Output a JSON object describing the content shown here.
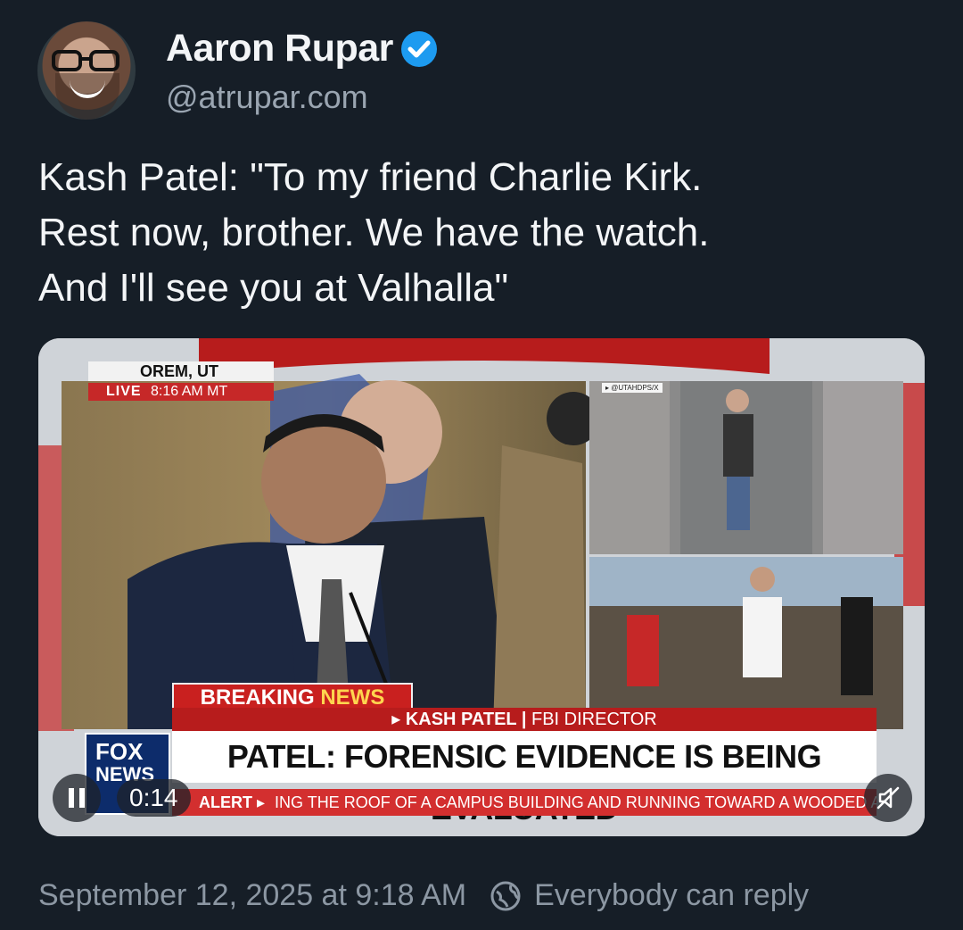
{
  "author": {
    "display_name": "Aaron Rupar",
    "handle": "@atrupar.com"
  },
  "post": {
    "text_lines": [
      "Kash Patel: \"To my friend Charlie Kirk.",
      "Rest now, brother. We have the watch.",
      "And I'll see you at Valhalla\""
    ]
  },
  "video": {
    "location": "OREM, UT",
    "live_label": "LIVE",
    "live_time": "8:16 AM MT",
    "source_tag": "▸ @UTAHDPS/X",
    "breaking": "BREAKING",
    "breaking_news": "NEWS",
    "speaker_name": "▸ KASH PATEL",
    "speaker_role": "FBI DIRECTOR",
    "headline": "PATEL: FORENSIC EVIDENCE IS BEING EVALUATED",
    "ticker_label": "ALERT ▸",
    "ticker_text": "ING THE ROOF OF A CAMPUS BUILDING AND RUNNING TOWARD A WOODED A",
    "network_top": "FOX",
    "network_bottom": "NEWS",
    "elapsed_time": "0:14"
  },
  "footer": {
    "timestamp": "September 12, 2025 at 9:18 AM",
    "reply_setting": "Everybody can reply"
  },
  "colors": {
    "background": "#161e27",
    "verified_badge": "#1d9bf0",
    "breaking_red": "#c9201f"
  },
  "icons": [
    "verified-badge-icon",
    "pause-icon",
    "mute-icon",
    "globe-reply-icon"
  ]
}
